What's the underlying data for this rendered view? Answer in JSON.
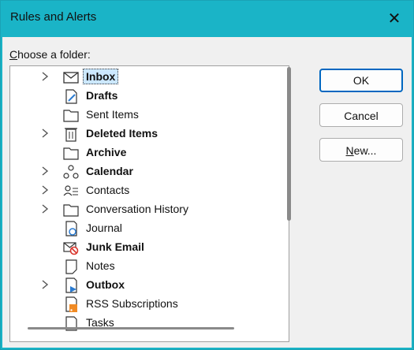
{
  "window": {
    "title": "Rules and Alerts",
    "close_label": "✕"
  },
  "choose": {
    "prefix": "C",
    "rest": "hoose a folder:"
  },
  "folders": [
    {
      "label": "Inbox",
      "bold": true,
      "chevron": true,
      "icon": "envelope-icon",
      "selected": true
    },
    {
      "label": "Drafts",
      "bold": true,
      "chevron": false,
      "icon": "drafts-icon"
    },
    {
      "label": "Sent Items",
      "bold": false,
      "chevron": false,
      "icon": "folder-icon"
    },
    {
      "label": "Deleted Items",
      "bold": true,
      "chevron": true,
      "icon": "trash-icon"
    },
    {
      "label": "Archive",
      "bold": true,
      "chevron": false,
      "icon": "archive-icon"
    },
    {
      "label": "Calendar",
      "bold": true,
      "chevron": true,
      "icon": "calendar-share-icon"
    },
    {
      "label": "Contacts",
      "bold": false,
      "chevron": true,
      "icon": "contacts-icon"
    },
    {
      "label": "Conversation History",
      "bold": false,
      "chevron": true,
      "icon": "folder-icon"
    },
    {
      "label": "Journal",
      "bold": false,
      "chevron": false,
      "icon": "journal-icon"
    },
    {
      "label": "Junk Email",
      "bold": true,
      "chevron": false,
      "icon": "junk-email-icon"
    },
    {
      "label": "Notes",
      "bold": false,
      "chevron": false,
      "icon": "notes-icon"
    },
    {
      "label": "Outbox",
      "bold": true,
      "chevron": true,
      "icon": "outbox-icon"
    },
    {
      "label": "RSS Subscriptions",
      "bold": false,
      "chevron": false,
      "icon": "rss-icon"
    },
    {
      "label": "Tasks",
      "bold": false,
      "chevron": false,
      "icon": "tasks-icon"
    }
  ],
  "buttons": {
    "ok": "OK",
    "cancel": "Cancel",
    "new_prefix": "N",
    "new_rest": "ew..."
  }
}
